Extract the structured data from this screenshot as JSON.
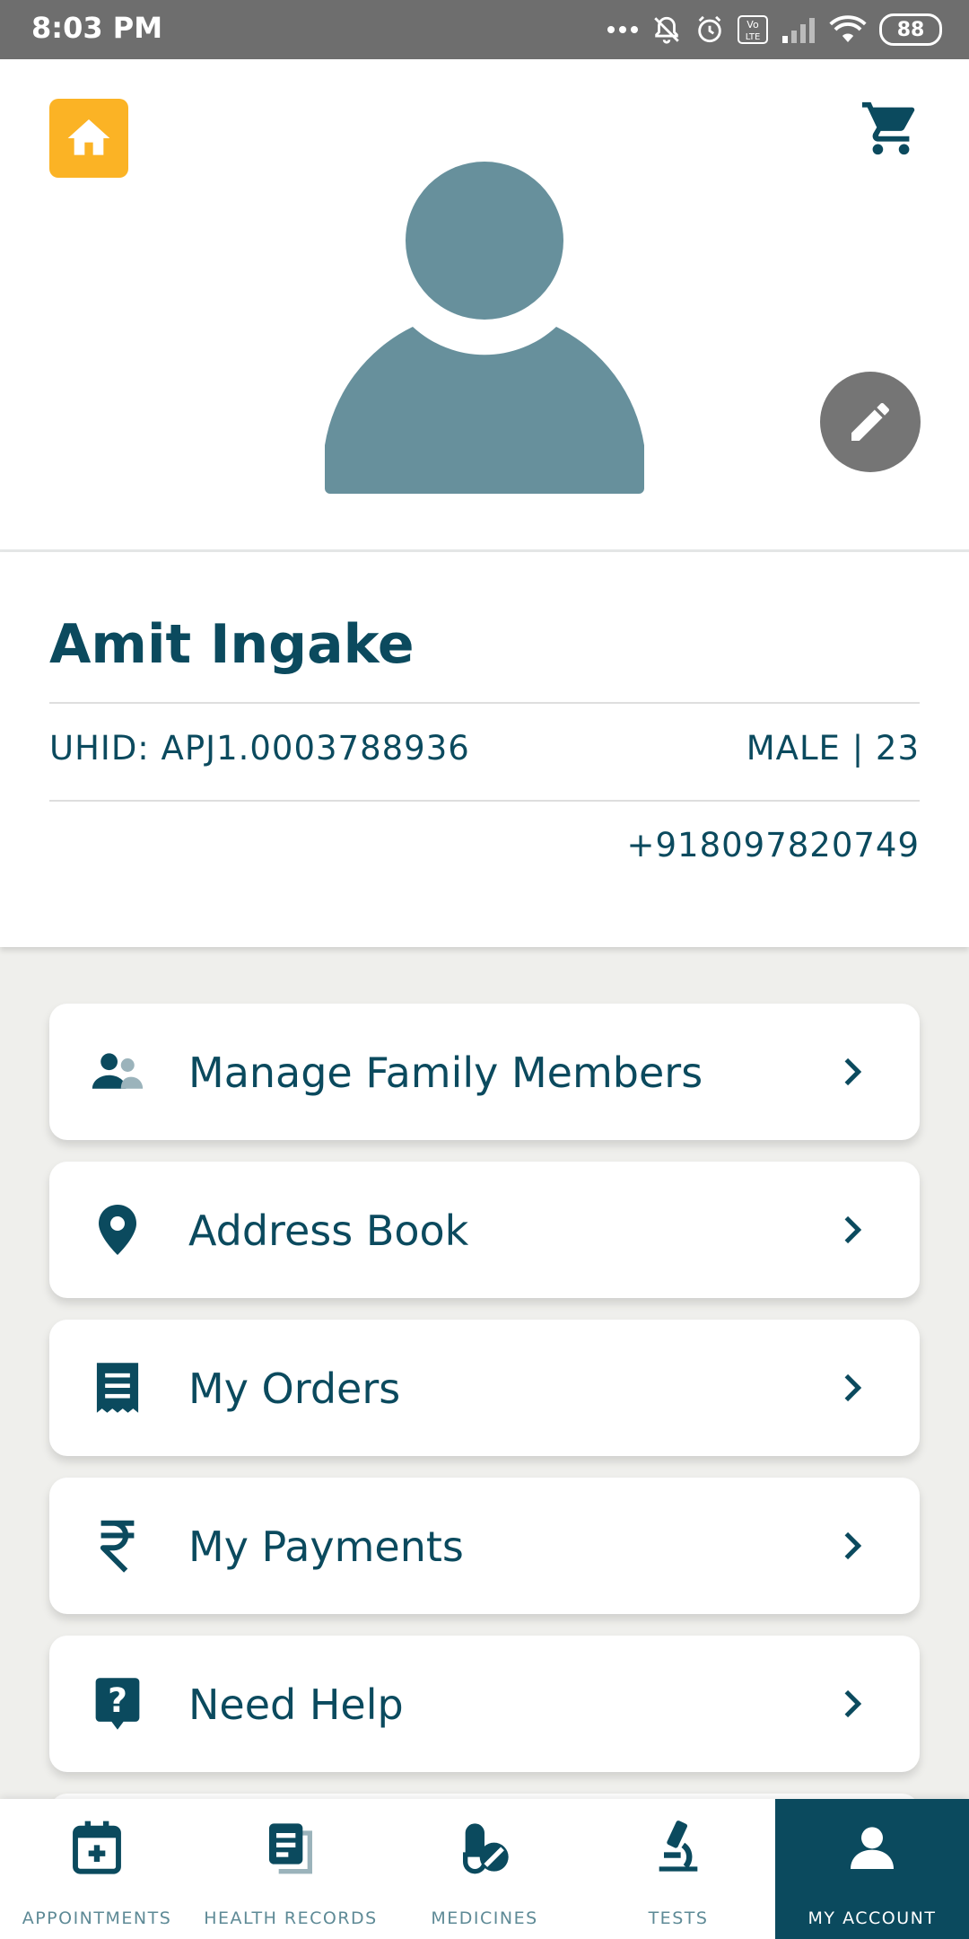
{
  "status_bar": {
    "time": "8:03 PM",
    "battery": "88"
  },
  "profile": {
    "name": "Amit Ingake",
    "uhid": "UHID: APJ1.0003788936",
    "gender_age": "MALE | 23",
    "phone": "+918097820749"
  },
  "menu": [
    {
      "label": "Manage Family Members",
      "icon": "family-icon"
    },
    {
      "label": "Address Book",
      "icon": "location-pin-icon"
    },
    {
      "label": "My Orders",
      "icon": "receipt-icon"
    },
    {
      "label": "My Payments",
      "icon": "rupee-icon"
    },
    {
      "label": "Need Help",
      "icon": "help-icon"
    }
  ],
  "bottom_nav": [
    {
      "label": "APPOINTMENTS",
      "icon": "calendar-plus-icon"
    },
    {
      "label": "HEALTH RECORDS",
      "icon": "health-records-icon"
    },
    {
      "label": "MEDICINES",
      "icon": "medicine-icon"
    },
    {
      "label": "TESTS",
      "icon": "microscope-icon"
    },
    {
      "label": "MY ACCOUNT",
      "icon": "account-icon",
      "active": true
    }
  ],
  "colors": {
    "primary": "#0b4a5e",
    "accent": "#fbb325",
    "avatar": "#67909c",
    "edit_button": "#757575",
    "nav_inactive": "#5e8a96"
  }
}
